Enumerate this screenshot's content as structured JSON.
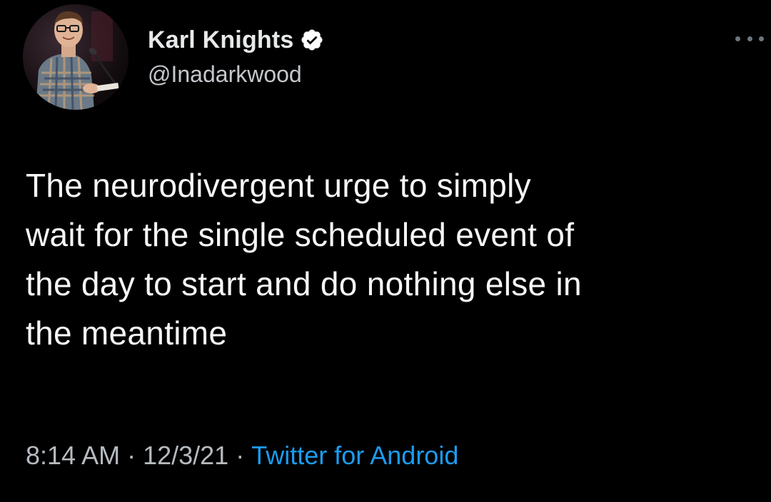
{
  "author": {
    "display_name": "Karl Knights",
    "handle": "@Inadarkwood",
    "verified": true
  },
  "tweet": {
    "text_lines": [
      "The neurodivergent urge to simply",
      "wait for the single scheduled event of",
      "the day to start and do nothing else in",
      "the meantime"
    ]
  },
  "meta": {
    "time": "8:14 AM",
    "separator": "·",
    "date": "12/3/21",
    "source": "Twitter for Android"
  },
  "icons": {
    "verified": "verified-badge-icon",
    "more": "more-options-icon"
  },
  "colors": {
    "background": "#000000",
    "link": "#1d9bf0",
    "text": "#e7e9ea",
    "secondary": "#b6bbc0"
  }
}
